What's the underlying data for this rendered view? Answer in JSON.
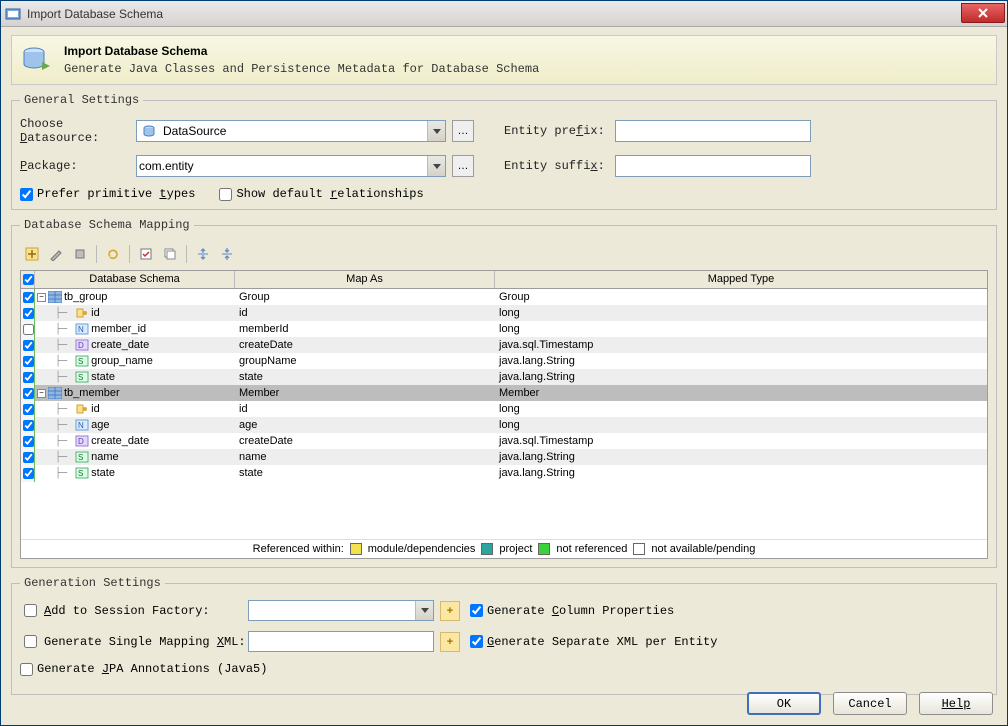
{
  "titlebar": {
    "title": "Import Database Schema"
  },
  "header": {
    "title": "Import Database Schema",
    "subtitle": "Generate Java Classes and Persistence Metadata for Database Schema"
  },
  "general": {
    "legend": "General Settings",
    "datasource_label": "Choose Datasource:",
    "datasource_value": "DataSource",
    "package_label": "Package:",
    "package_value": "com.entity",
    "entity_prefix_label": "Entity prefix:",
    "entity_prefix_value": "",
    "entity_suffix_label": "Entity suffix:",
    "entity_suffix_value": "",
    "prefer_primitive": "Prefer primitive types",
    "prefer_primitive_checked": true,
    "show_default_rel": "Show default relationships",
    "show_default_rel_checked": false
  },
  "mapping": {
    "legend": "Database Schema Mapping",
    "columns": {
      "c1": "Database Schema",
      "c2": "Map As",
      "c3": "Mapped Type"
    },
    "rows": [
      {
        "chk": true,
        "depth": 0,
        "expander": "-",
        "icon": "table",
        "name": "tb_group",
        "mapas": "Group",
        "type": "Group",
        "alt": false
      },
      {
        "chk": true,
        "depth": 1,
        "icon": "pk",
        "name": "id",
        "mapas": "id",
        "type": "long",
        "alt": true
      },
      {
        "chk": false,
        "depth": 1,
        "icon": "col-num",
        "name": "member_id",
        "mapas": "memberId",
        "type": "long",
        "alt": false
      },
      {
        "chk": true,
        "depth": 1,
        "icon": "col-date",
        "name": "create_date",
        "mapas": "createDate",
        "type": "java.sql.Timestamp",
        "alt": true
      },
      {
        "chk": true,
        "depth": 1,
        "icon": "col-str",
        "name": "group_name",
        "mapas": "groupName",
        "type": "java.lang.String",
        "alt": false
      },
      {
        "chk": true,
        "depth": 1,
        "icon": "col-str",
        "name": "state",
        "mapas": "state",
        "type": "java.lang.String",
        "alt": true
      },
      {
        "chk": true,
        "depth": 0,
        "expander": "-",
        "icon": "table",
        "name": "tb_member",
        "mapas": "Member",
        "type": "Member",
        "sel": true
      },
      {
        "chk": true,
        "depth": 1,
        "icon": "pk",
        "name": "id",
        "mapas": "id",
        "type": "long",
        "alt": false
      },
      {
        "chk": true,
        "depth": 1,
        "icon": "col-num",
        "name": "age",
        "mapas": "age",
        "type": "long",
        "alt": true
      },
      {
        "chk": true,
        "depth": 1,
        "icon": "col-date",
        "name": "create_date",
        "mapas": "createDate",
        "type": "java.sql.Timestamp",
        "alt": false
      },
      {
        "chk": true,
        "depth": 1,
        "icon": "col-str",
        "name": "name",
        "mapas": "name",
        "type": "java.lang.String",
        "alt": true
      },
      {
        "chk": true,
        "depth": 1,
        "icon": "col-str",
        "name": "state",
        "mapas": "state",
        "type": "java.lang.String",
        "alt": false
      }
    ],
    "legend_strip": {
      "label": "Referenced within:",
      "items": [
        {
          "color": "#f4e24d",
          "text": "module/dependencies"
        },
        {
          "color": "#2aa5a0",
          "text": "project"
        },
        {
          "color": "#3cd23c",
          "text": "not referenced"
        },
        {
          "color": "#ffffff",
          "text": "not available/pending"
        }
      ]
    }
  },
  "generation": {
    "legend": "Generation Settings",
    "add_session": "Add to Session Factory:",
    "gen_single": "Generate Single Mapping XML:",
    "gen_jpa": "Generate JPA Annotations (Java5)",
    "gen_col_props": "Generate Column Properties",
    "gen_sep_xml": "Generate Separate XML per Entity"
  },
  "buttons": {
    "ok": "OK",
    "cancel": "Cancel",
    "help": "Help"
  }
}
